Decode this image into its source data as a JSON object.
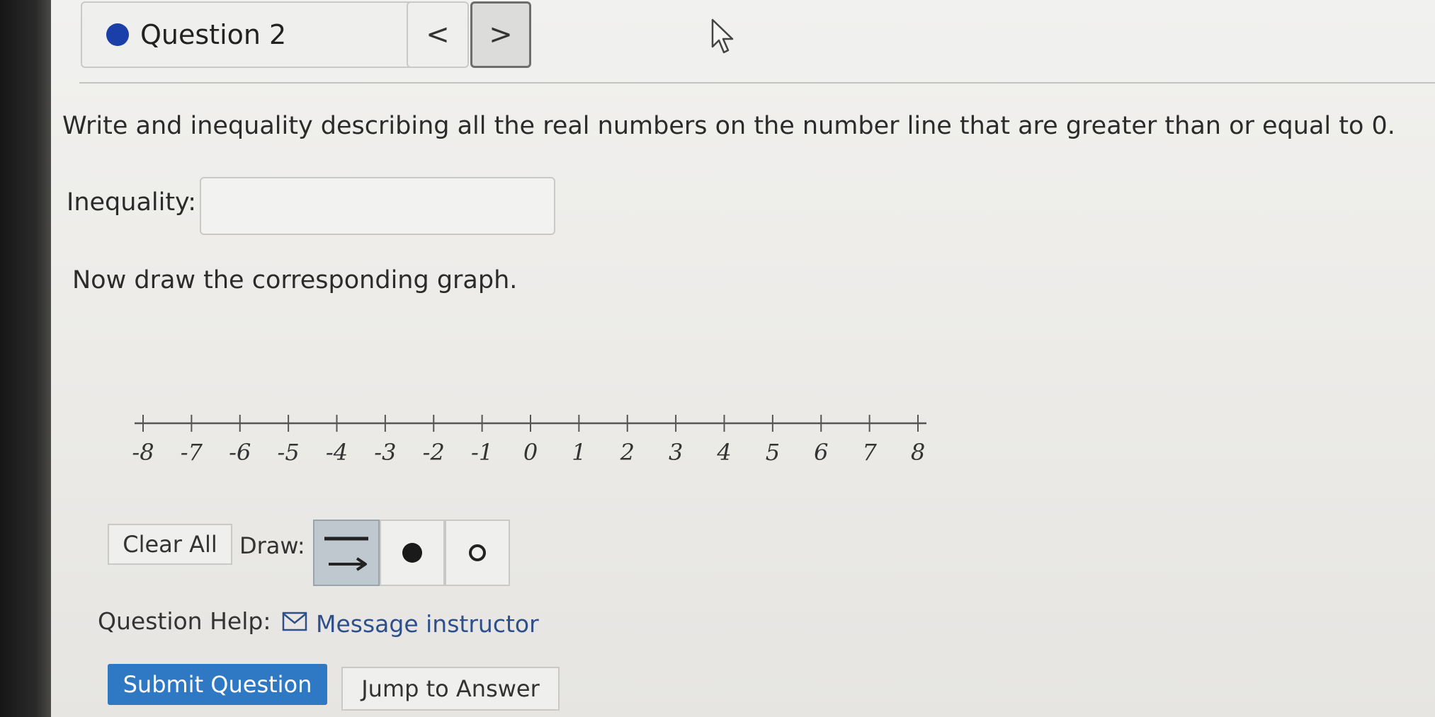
{
  "header": {
    "question_label": "Question 2",
    "prev_symbol": "<",
    "next_symbol": ">"
  },
  "prompt": "Write and inequality describing all the real numbers on the number line that are greater than or equal to 0.",
  "inequality": {
    "label": "Inequality:",
    "value": ""
  },
  "graph_prompt": "Now draw the corresponding graph.",
  "number_line": {
    "min": -8,
    "max": 8,
    "tick_labels": [
      "-8",
      "-7",
      "-6",
      "-5",
      "-4",
      "-3",
      "-2",
      "-1",
      "0",
      "1",
      "2",
      "3",
      "4",
      "5",
      "6",
      "7",
      "8"
    ]
  },
  "toolbar": {
    "clear_label": "Clear All",
    "draw_label": "Draw:",
    "tools": [
      "ray-tool",
      "closed-dot-tool",
      "open-dot-tool"
    ],
    "selected_tool": "ray-tool"
  },
  "help": {
    "label": "Question Help:",
    "link_text": "Message instructor"
  },
  "actions": {
    "submit_label": "Submit Question",
    "jump_label": "Jump to Answer"
  },
  "colors": {
    "accent": "#2f78c4",
    "question_dot": "#1b3fa8",
    "link": "#2d4f8a"
  }
}
